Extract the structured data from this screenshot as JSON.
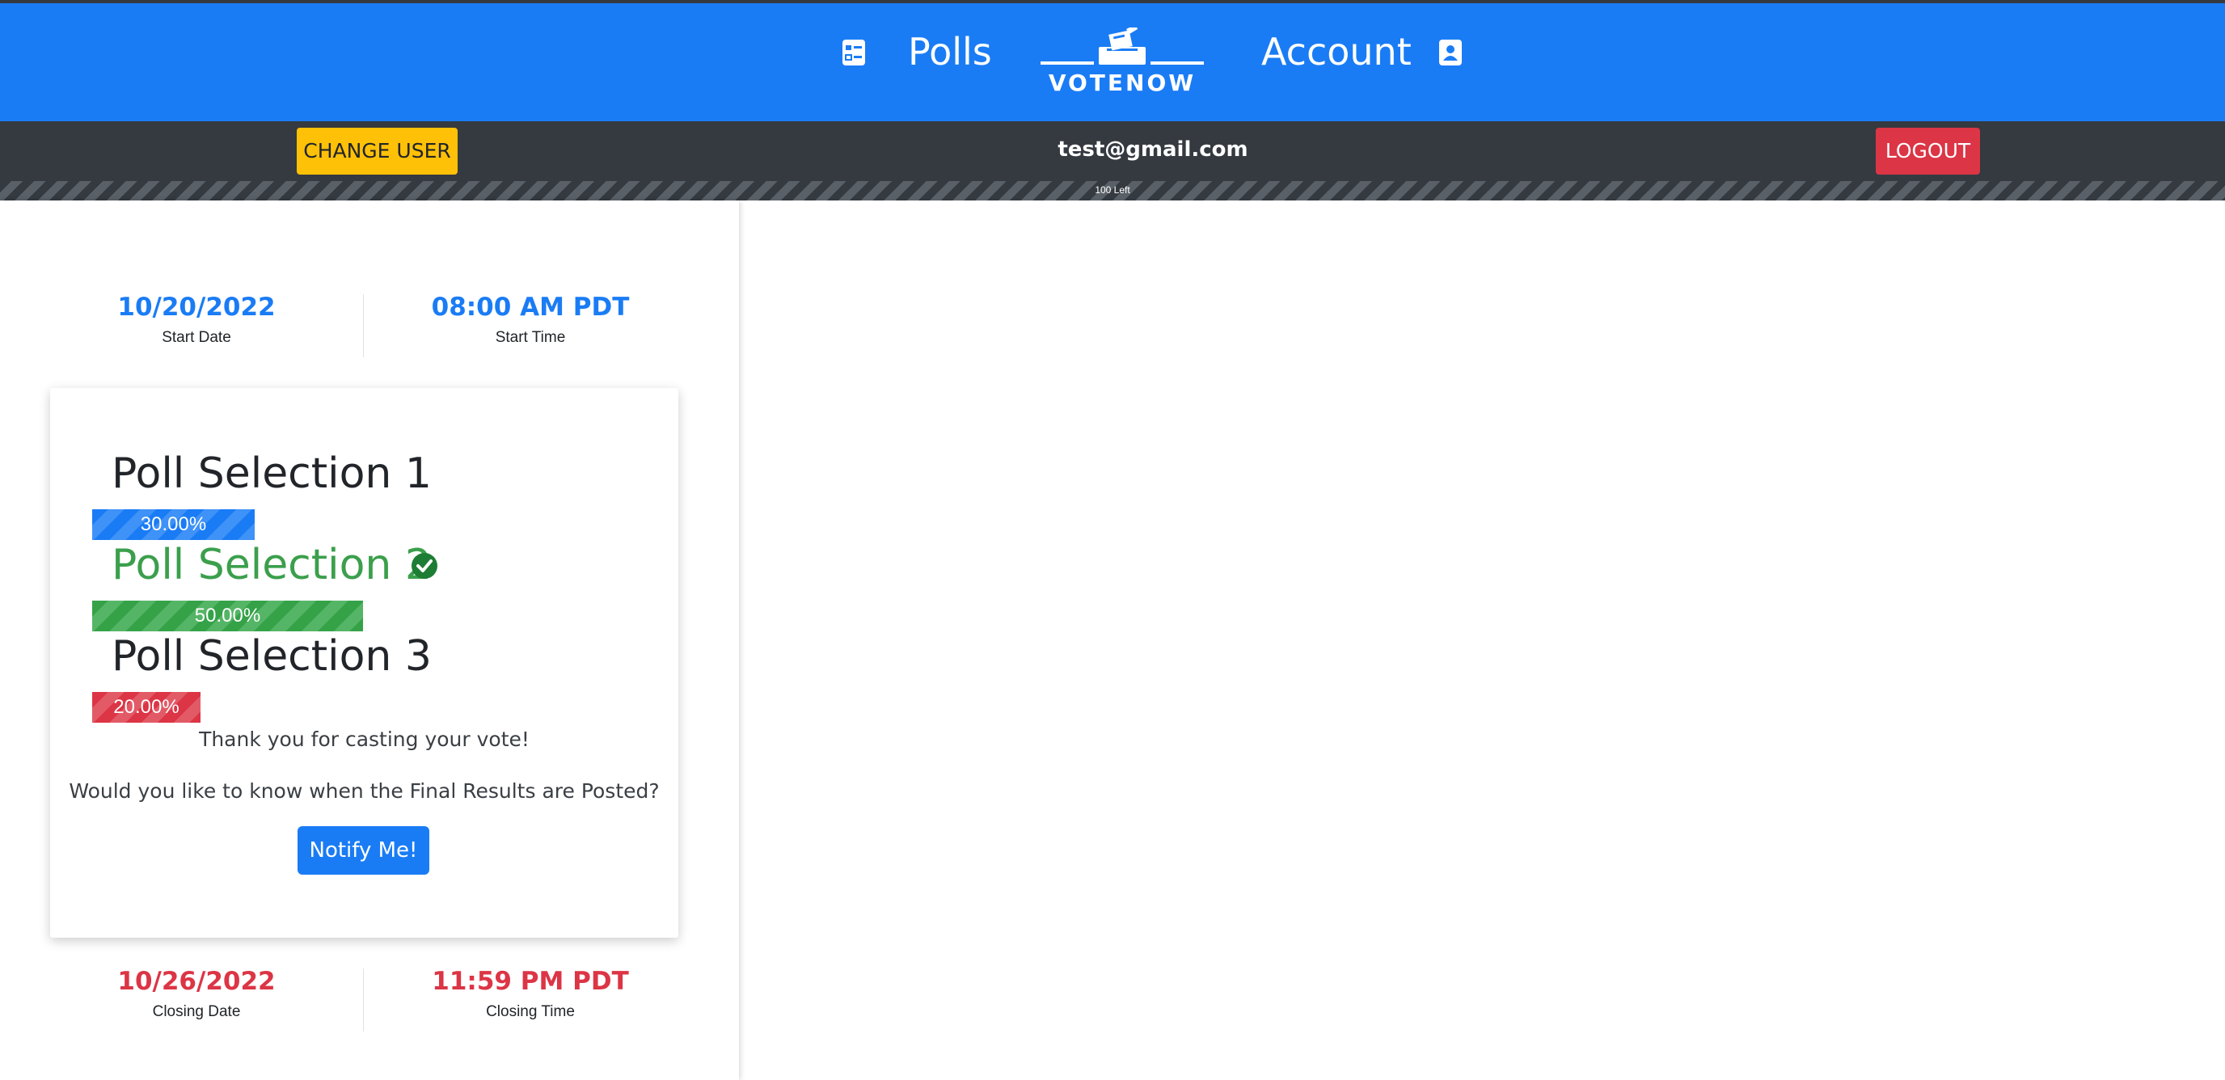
{
  "navbar": {
    "polls_label": "Polls",
    "account_label": "Account",
    "logo_text": "VOTENOW",
    "icons": [
      "list-icon",
      "ballot-box-logo",
      "account-icon"
    ],
    "color": "#1a7cf5"
  },
  "userbar": {
    "change_user_label": "CHANGE USER",
    "email": "test@gmail.com",
    "logout_label": "LOGOUT",
    "remaining_label": "100 Left"
  },
  "poll": {
    "start_date": "10/20/2022",
    "start_date_label": "Start Date",
    "start_time": "08:00 AM PDT",
    "start_time_label": "Start Time",
    "closing_date": "10/26/2022",
    "closing_date_label": "Closing Date",
    "closing_time": "11:59 PM PDT",
    "closing_time_label": "Closing Time",
    "selections": [
      {
        "name": "Poll Selection 1",
        "percent_label": "30.00%",
        "percent": 30,
        "color": "#1a7cf5",
        "voted": false
      },
      {
        "name": "Poll Selection 2",
        "percent_label": "50.00%",
        "percent": 50,
        "color": "#35a248",
        "voted": true
      },
      {
        "name": "Poll Selection 3",
        "percent_label": "20.00%",
        "percent": 20,
        "color": "#dc3545",
        "voted": false
      }
    ],
    "thank_you": "Thank you for casting your vote!",
    "question": "Would you like to know when the Final Results are Posted?",
    "notify_label": "Notify Me!"
  }
}
